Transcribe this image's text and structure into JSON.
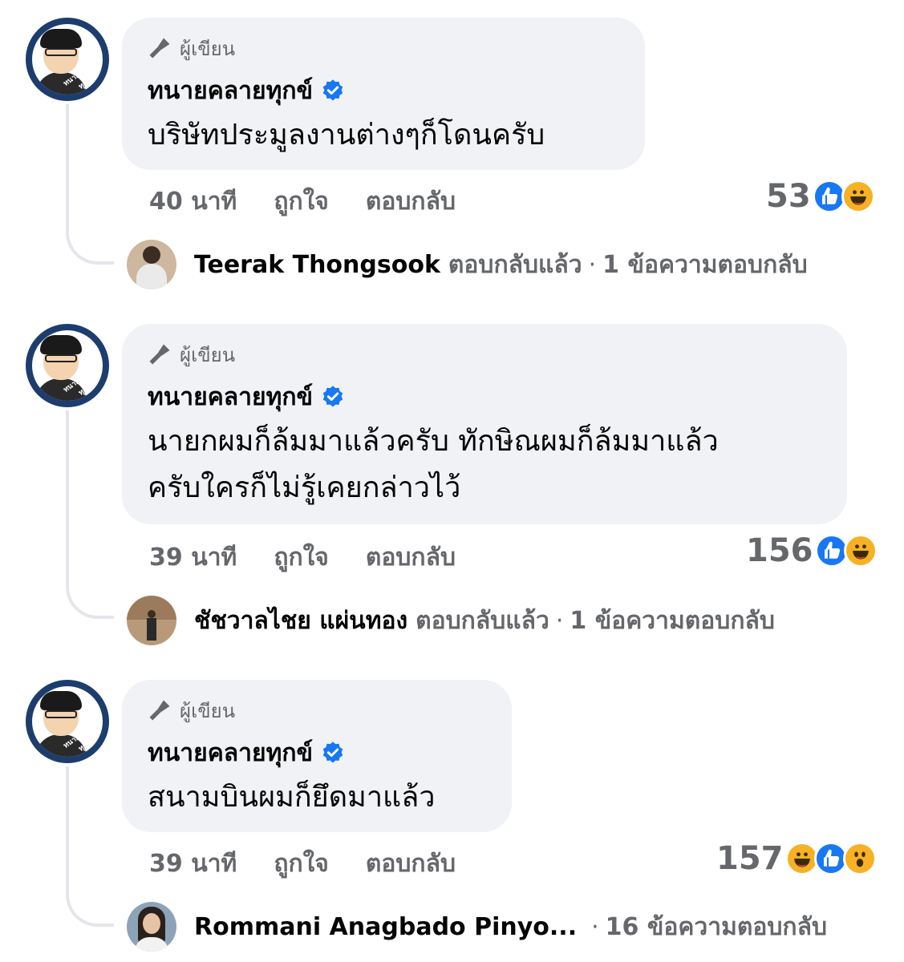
{
  "comments": [
    {
      "author_badge": "ผู้เขียน",
      "author": "ทนายคลายทุกข์",
      "text_lines": [
        "บริษัทประมูลงานต่างๆก็โดนครับ"
      ],
      "time": "40 นาที",
      "like_label": "ถูกใจ",
      "reply_label": "ตอบกลับ",
      "reaction_count": "53",
      "reactions": [
        "like-icon",
        "haha-icon"
      ],
      "reply": {
        "name": "Teerak Thongsook",
        "action": "ตอบกลับแล้ว",
        "count_text": "1 ข้อความตอบกลับ"
      }
    },
    {
      "author_badge": "ผู้เขียน",
      "author": "ทนายคลายทุกข์",
      "text_lines": [
        "นายกผมก็ล้มมาแล้วครับ ทักษิณผมก็ล้มมาแล้ว",
        "ครับใครก็ไม่รู้เคยกล่าวไว้"
      ],
      "time": "39 นาที",
      "like_label": "ถูกใจ",
      "reply_label": "ตอบกลับ",
      "reaction_count": "156",
      "reactions": [
        "like-icon",
        "haha-icon"
      ],
      "reply": {
        "name": "ชัชวาลไชย แผ่นทอง",
        "action": "ตอบกลับแล้ว",
        "count_text": "1 ข้อความตอบกลับ"
      }
    },
    {
      "author_badge": "ผู้เขียน",
      "author": "ทนายคลายทุกข์",
      "text_lines": [
        "สนามบินผมก็ยึดมาแล้ว"
      ],
      "time": "39 นาที",
      "like_label": "ถูกใจ",
      "reply_label": "ตอบกลับ",
      "reaction_count": "157",
      "reactions": [
        "haha-icon",
        "like-icon",
        "wow-icon"
      ],
      "reply": {
        "name": "Rommani Anagbado Pinyo...",
        "action": "",
        "count_text": "16 ข้อความตอบกลับ"
      }
    }
  ],
  "avatar_ring_text": "ทนายคลายทุกข์",
  "colors": {
    "bubble": "#f0f2f5",
    "secondary_text": "#65676b",
    "like_blue": "#1877f2",
    "haha_yellow": "#f7b125"
  }
}
